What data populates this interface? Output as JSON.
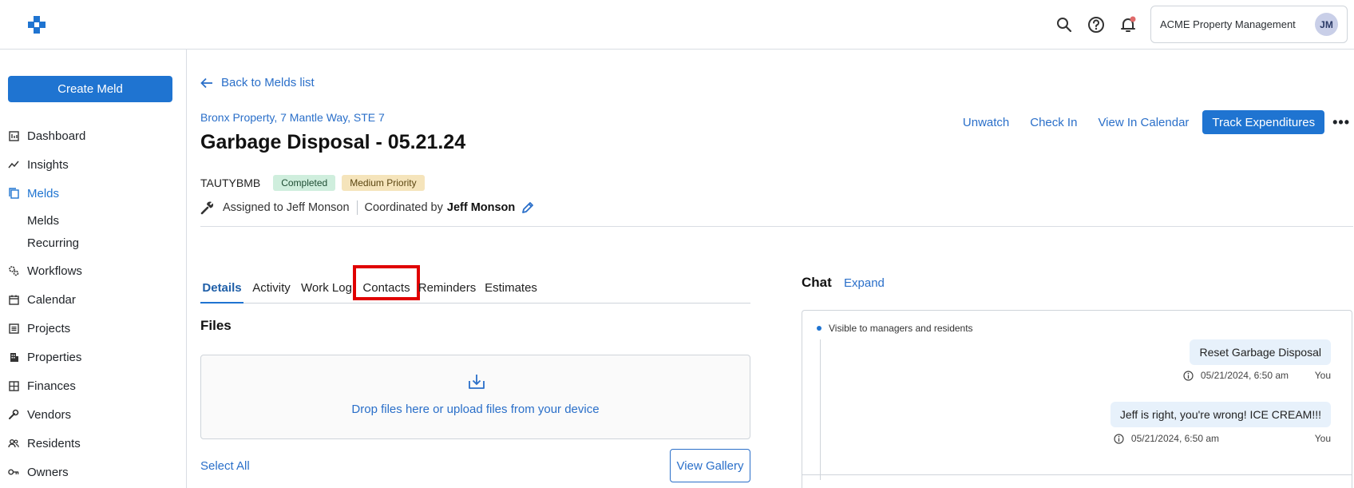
{
  "topbar": {
    "org_name": "ACME Property Management",
    "avatar_initials": "JM",
    "brand_color": "#1f74d1",
    "notification_dot_color": "#e06a6a"
  },
  "sidebar": {
    "create_label": "Create Meld",
    "items": [
      {
        "label": "Dashboard",
        "icon": "dashboard-icon"
      },
      {
        "label": "Insights",
        "icon": "insights-icon"
      },
      {
        "label": "Melds",
        "icon": "melds-icon",
        "active": true
      },
      {
        "label": "Workflows",
        "icon": "workflows-icon"
      },
      {
        "label": "Calendar",
        "icon": "calendar-icon"
      },
      {
        "label": "Projects",
        "icon": "projects-icon"
      },
      {
        "label": "Properties",
        "icon": "properties-icon"
      },
      {
        "label": "Finances",
        "icon": "finances-icon"
      },
      {
        "label": "Vendors",
        "icon": "vendors-icon"
      },
      {
        "label": "Residents",
        "icon": "residents-icon"
      },
      {
        "label": "Owners",
        "icon": "owners-icon"
      }
    ],
    "sub_items": [
      "Melds",
      "Recurring"
    ]
  },
  "main": {
    "back_label": "Back to Melds list",
    "address": "Bronx Property, 7 Mantle Way, STE 7",
    "title": "Garbage Disposal - 05.21.24",
    "code": "TAUTYBMB",
    "status_badge": "Completed",
    "priority_badge": "Medium Priority",
    "assigned_text": "Assigned to Jeff Monson",
    "coordinated_prefix": "Coordinated by",
    "coordinator": "Jeff Monson",
    "actions": {
      "unwatch": "Unwatch",
      "check_in": "Check In",
      "view_calendar": "View In Calendar",
      "track": "Track Expenditures",
      "more": "•••"
    },
    "tabs": [
      "Details",
      "Activity",
      "Work Log",
      "Contacts",
      "Reminders",
      "Estimates"
    ],
    "active_tab": "Details",
    "highlighted_tab": "Contacts",
    "files_heading": "Files",
    "drop_text": "Drop files here or upload files from your device",
    "select_all": "Select All",
    "view_gallery": "View Gallery"
  },
  "chat": {
    "heading": "Chat",
    "expand": "Expand",
    "visibility": "Visible to managers and residents",
    "messages": [
      {
        "text": "Reset Garbage Disposal",
        "time": "05/21/2024, 6:50 am",
        "author": "You"
      },
      {
        "text": "Jeff is right, you're wrong! ICE CREAM!!!",
        "time": "05/21/2024, 6:50 am",
        "author": "You"
      }
    ]
  }
}
